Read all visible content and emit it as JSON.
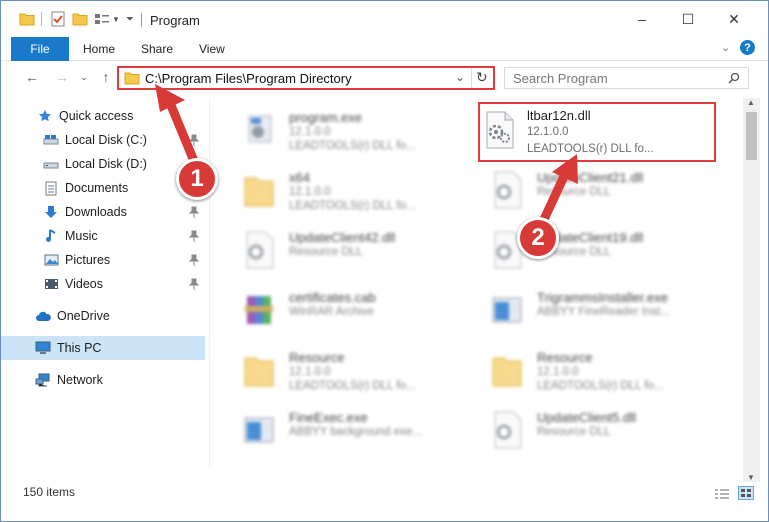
{
  "window": {
    "title": "Program",
    "minimize": "–",
    "maximize": "☐",
    "close": "✕"
  },
  "ribbon": {
    "file": "File",
    "tabs": [
      "Home",
      "Share",
      "View"
    ]
  },
  "address": {
    "path": "C:\\Program Files\\Program Directory",
    "search_placeholder": "Search Program"
  },
  "sidebar": {
    "items": [
      {
        "label": "Quick access",
        "icon": "star-icon"
      },
      {
        "label": "Local Disk (C:)",
        "icon": "drive-icon"
      },
      {
        "label": "Local Disk (D:)",
        "icon": "drive-icon"
      },
      {
        "label": "Documents",
        "icon": "documents-icon"
      },
      {
        "label": "Downloads",
        "icon": "download-icon"
      },
      {
        "label": "Music",
        "icon": "music-icon"
      },
      {
        "label": "Pictures",
        "icon": "pictures-icon"
      },
      {
        "label": "Videos",
        "icon": "videos-icon"
      },
      {
        "label": "OneDrive",
        "icon": "cloud-icon"
      },
      {
        "label": "This PC",
        "icon": "computer-icon"
      },
      {
        "label": "Network",
        "icon": "network-icon"
      }
    ]
  },
  "files": [
    {
      "name": "program.exe",
      "line2": "12.1.0.0",
      "line3": "LEADTOOLS(r) DLL fo...",
      "icon": "exe-icon"
    },
    {
      "name": "ltbar12n.dll",
      "line2": "12.1.0.0",
      "line3": "LEADTOOLS(r) DLL fo...",
      "icon": "dll-icon"
    },
    {
      "name": "x64",
      "line2": "12.1.0.0",
      "line3": "LEADTOOLS(r) DLL fo...",
      "icon": "folder-icon"
    },
    {
      "name": "UpdateClient21.dll",
      "line2": "Resource DLL",
      "line3": "",
      "icon": "dll-icon"
    },
    {
      "name": "UpdateClient42.dll",
      "line2": "Resource DLL",
      "line3": "",
      "icon": "dll-icon"
    },
    {
      "name": "UpdateClient19.dll",
      "line2": "Resource DLL",
      "line3": "",
      "icon": "dll-icon"
    },
    {
      "name": "certificates.cab",
      "line2": "WinRAR Archive",
      "line3": "",
      "icon": "archive-icon"
    },
    {
      "name": "TrigrammsInstaller.exe",
      "line2": "ABBYY FineReader Inst...",
      "line3": "",
      "icon": "exe-icon"
    },
    {
      "name": "Resource",
      "line2": "12.1.0.0",
      "line3": "LEADTOOLS(r) DLL fo...",
      "icon": "folder-icon"
    },
    {
      "name": "Resource",
      "line2": "12.1.0.0",
      "line3": "LEADTOOLS(r) DLL fo...",
      "icon": "folder-icon"
    },
    {
      "name": "FineExec.exe",
      "line2": "ABBYY background exe...",
      "line3": "",
      "icon": "exe-icon"
    },
    {
      "name": "UpdateClient5.dll",
      "line2": "Resource DLL",
      "line3": "",
      "icon": "dll-icon"
    }
  ],
  "status": {
    "count": "150 items"
  },
  "annotations": {
    "step1": "1",
    "step2": "2",
    "color": "#d83a37"
  }
}
